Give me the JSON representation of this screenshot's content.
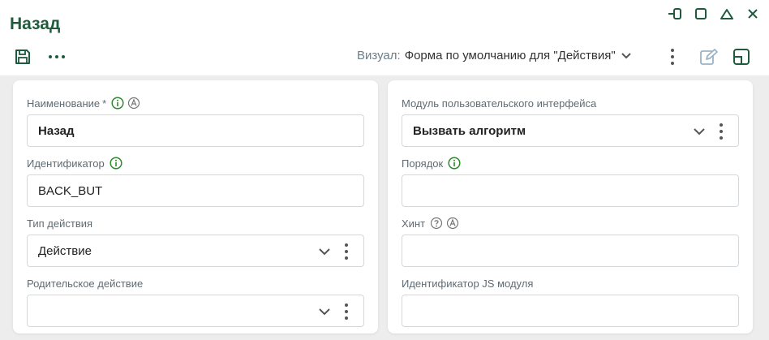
{
  "header": {
    "title": "Назад",
    "visual_label": "Визуал:",
    "visual_value": "Форма по умолчанию для \"Действия\""
  },
  "icons": {
    "save": "save-icon",
    "more": "more-horizontal-icon",
    "edit": "edit-icon",
    "open_window": "open-window-icon",
    "pin": "pin-icon",
    "maximize": "maximize-icon",
    "collapse": "collapse-icon",
    "close": "close-icon"
  },
  "colors": {
    "title": "#1e5b3c",
    "info": "#2e8b2e",
    "label": "#5f6b73",
    "border": "#d4d8db"
  },
  "left": {
    "name": {
      "label": "Наименование",
      "required_mark": "*",
      "value": "Назад"
    },
    "identifier": {
      "label": "Идентификатор",
      "value": "BACK_BUT"
    },
    "action_type": {
      "label": "Тип действия",
      "value": "Действие"
    },
    "parent_action": {
      "label": "Родительское действие",
      "value": ""
    }
  },
  "right": {
    "ui_module": {
      "label": "Модуль пользовательского интерфейса",
      "value": "Вызвать алгоритм"
    },
    "order": {
      "label": "Порядок",
      "value": ""
    },
    "hint": {
      "label": "Хинт",
      "value": ""
    },
    "js_module_id": {
      "label": "Идентификатор JS модуля",
      "value": ""
    }
  }
}
